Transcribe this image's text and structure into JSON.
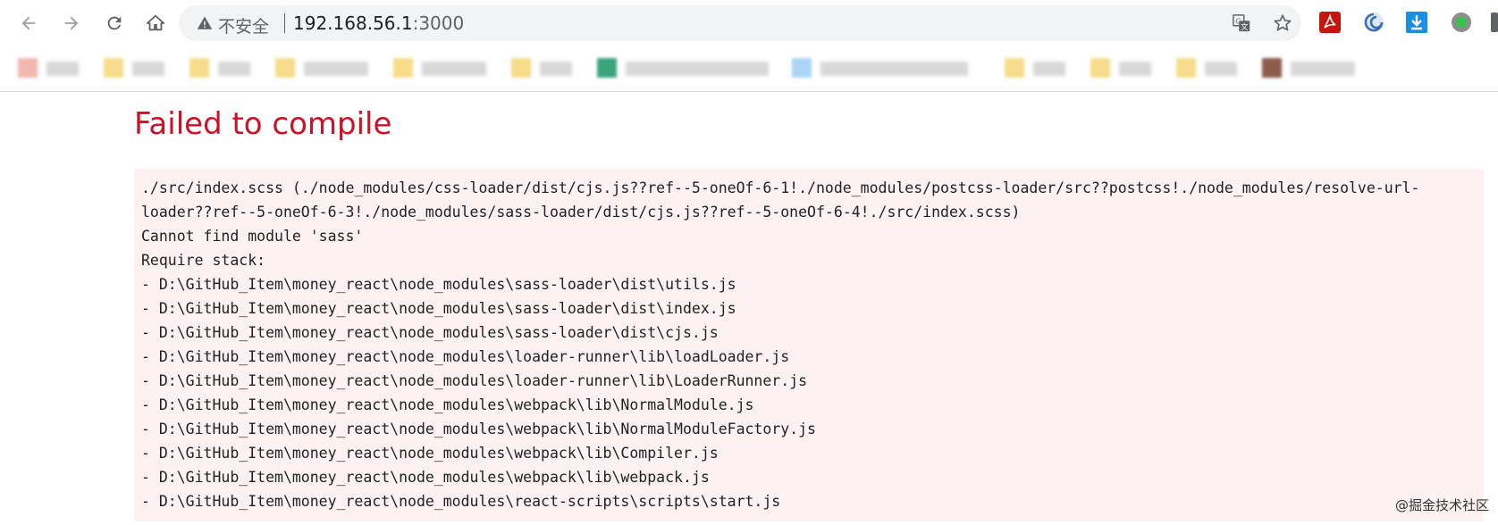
{
  "address_bar": {
    "security_label": "不安全",
    "url_host": "192.168.56.1",
    "url_port": ":3000"
  },
  "icons": {
    "back": "back-arrow-icon",
    "forward": "forward-arrow-icon",
    "reload": "reload-icon",
    "home": "home-icon",
    "warning": "warning-triangle-icon",
    "translate": "translate-icon",
    "bookmark_star": "star-icon",
    "extensions": [
      "pdf-extension-icon",
      "swirl-extension-icon",
      "download-extension-icon",
      "green-dot-extension-icon"
    ]
  },
  "bookmarks_bar": {
    "note": "",
    "items": [
      {
        "icon_color": "#f2b8b0"
      },
      {
        "icon_color": "#f7dd8a"
      },
      {
        "icon_color": "#f7dd8a"
      },
      {
        "icon_color": "#f7dd8a"
      },
      {
        "icon_color": "#f7dd8a"
      },
      {
        "icon_color": "#f7dd8a"
      },
      {
        "icon_color": "#3aa57d"
      },
      {
        "icon_color": "#a9d6f5"
      },
      {
        "icon_color": "#f7dd8a"
      },
      {
        "icon_color": "#f7dd8a"
      },
      {
        "icon_color": "#f7dd8a"
      },
      {
        "icon_color": "#8d5b4c"
      }
    ]
  },
  "error": {
    "title": "Failed to compile",
    "lines": [
      "./src/index.scss (./node_modules/css-loader/dist/cjs.js??ref--5-oneOf-6-1!./node_modules/postcss-loader/src??postcss!./node_modules/resolve-url-",
      "loader??ref--5-oneOf-6-3!./node_modules/sass-loader/dist/cjs.js??ref--5-oneOf-6-4!./src/index.scss)",
      "Cannot find module 'sass'",
      "Require stack:",
      "- D:\\GitHub_Item\\money_react\\node_modules\\sass-loader\\dist\\utils.js",
      "- D:\\GitHub_Item\\money_react\\node_modules\\sass-loader\\dist\\index.js",
      "- D:\\GitHub_Item\\money_react\\node_modules\\sass-loader\\dist\\cjs.js",
      "- D:\\GitHub_Item\\money_react\\node_modules\\loader-runner\\lib\\loadLoader.js",
      "- D:\\GitHub_Item\\money_react\\node_modules\\loader-runner\\lib\\LoaderRunner.js",
      "- D:\\GitHub_Item\\money_react\\node_modules\\webpack\\lib\\NormalModule.js",
      "- D:\\GitHub_Item\\money_react\\node_modules\\webpack\\lib\\NormalModuleFactory.js",
      "- D:\\GitHub_Item\\money_react\\node_modules\\webpack\\lib\\Compiler.js",
      "- D:\\GitHub_Item\\money_react\\node_modules\\webpack\\lib\\webpack.js",
      "- D:\\GitHub_Item\\money_react\\node_modules\\react-scripts\\scripts\\start.js"
    ]
  },
  "watermark": "@掘金技术社区",
  "colors": {
    "error_title": "#ce1126",
    "error_background": "#fdf1f1",
    "omnibox_background": "#f1f3f4"
  }
}
